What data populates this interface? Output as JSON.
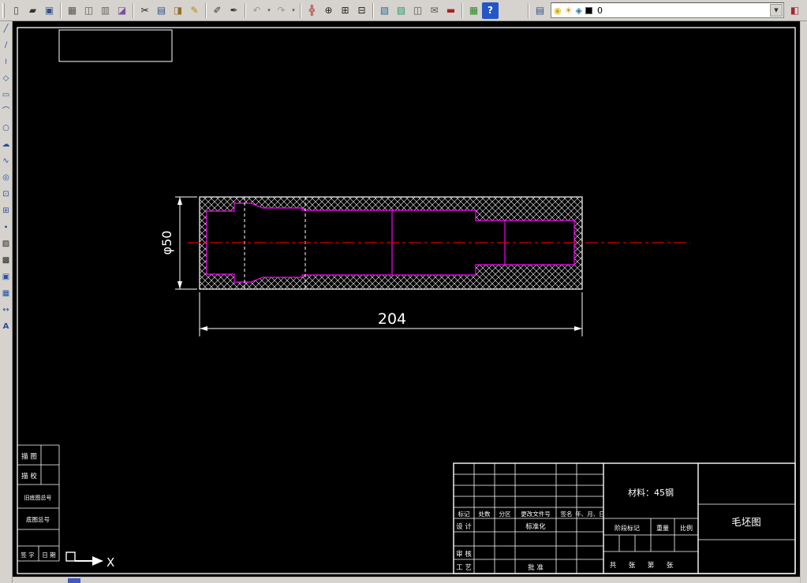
{
  "toolbar_top": {
    "items": [
      {
        "name": "toolbar-grip",
        "glyph": "",
        "cls": "tb-grip",
        "style": "",
        "inter": "true"
      },
      {
        "name": "new-file-icon",
        "glyph": "▯",
        "cls": "tb-btn",
        "style": "color:#444",
        "inter": "true"
      },
      {
        "name": "open-file-icon",
        "glyph": "▰",
        "cls": "tb-btn",
        "style": "color:#333",
        "inter": "true"
      },
      {
        "name": "save-icon",
        "glyph": "▣",
        "cls": "tb-btn",
        "style": "color:#35518f",
        "inter": "true"
      },
      {
        "name": "separator",
        "glyph": "",
        "cls": "tb-sep",
        "style": "",
        "inter": "false"
      },
      {
        "name": "print-icon",
        "glyph": "▦",
        "cls": "tb-btn",
        "style": "color:#555",
        "inter": "true"
      },
      {
        "name": "print-preview-icon",
        "glyph": "◫",
        "cls": "tb-btn",
        "style": "color:#555",
        "inter": "true"
      },
      {
        "name": "plot-icon",
        "glyph": "▥",
        "cls": "tb-btn",
        "style": "color:#666",
        "inter": "true"
      },
      {
        "name": "publish-icon",
        "glyph": "◪",
        "cls": "tb-btn",
        "style": "color:#7a4fa0",
        "inter": "true"
      },
      {
        "name": "separator",
        "glyph": "",
        "cls": "tb-sep",
        "style": "",
        "inter": "false"
      },
      {
        "name": "cut-icon",
        "glyph": "✂",
        "cls": "tb-btn",
        "style": "color:#222",
        "inter": "true"
      },
      {
        "name": "copy-icon",
        "glyph": "▤",
        "cls": "tb-btn",
        "style": "color:#35518f",
        "inter": "true"
      },
      {
        "name": "paste-icon",
        "glyph": "◨",
        "cls": "tb-btn",
        "style": "color:#946f27",
        "inter": "true"
      },
      {
        "name": "match-properties-icon",
        "glyph": "✎",
        "cls": "tb-btn",
        "style": "color:#b8860b",
        "inter": "true"
      },
      {
        "name": "separator",
        "glyph": "",
        "cls": "tb-sep",
        "style": "",
        "inter": "false"
      },
      {
        "name": "pencil-edit-icon",
        "glyph": "✐",
        "cls": "tb-btn",
        "style": "color:#333",
        "inter": "true"
      },
      {
        "name": "pen-edit-icon",
        "glyph": "✒",
        "cls": "tb-btn",
        "style": "color:#333",
        "inter": "true"
      },
      {
        "name": "separator",
        "glyph": "",
        "cls": "tb-sep",
        "style": "",
        "inter": "false"
      },
      {
        "name": "undo-icon",
        "glyph": "↶",
        "cls": "tb-btn",
        "style": "color:#999",
        "inter": "true"
      },
      {
        "name": "undo-caret-icon",
        "glyph": "▾",
        "cls": "tb-caret",
        "style": "",
        "inter": "true"
      },
      {
        "name": "redo-icon",
        "glyph": "↷",
        "cls": "tb-btn",
        "style": "color:#999",
        "inter": "true"
      },
      {
        "name": "redo-caret-icon",
        "glyph": "▾",
        "cls": "tb-caret",
        "style": "",
        "inter": "true"
      },
      {
        "name": "separator",
        "glyph": "",
        "cls": "tb-sep",
        "style": "",
        "inter": "false"
      },
      {
        "name": "pan-icon",
        "glyph": "╬",
        "cls": "tb-btn",
        "style": "color:#b22222",
        "inter": "true"
      },
      {
        "name": "zoom-realtime-icon",
        "glyph": "⊕",
        "cls": "tb-btn",
        "style": "color:#222",
        "inter": "true"
      },
      {
        "name": "zoom-window-icon",
        "glyph": "⊞",
        "cls": "tb-btn",
        "style": "color:#222",
        "inter": "true"
      },
      {
        "name": "zoom-previous-icon",
        "glyph": "⊟",
        "cls": "tb-btn",
        "style": "color:#222",
        "inter": "true"
      },
      {
        "name": "separator",
        "glyph": "",
        "cls": "tb-sep",
        "style": "",
        "inter": "false"
      },
      {
        "name": "design-center-icon",
        "glyph": "▧",
        "cls": "tb-btn",
        "style": "color:#2a6a9a",
        "inter": "true"
      },
      {
        "name": "tool-palettes-icon",
        "glyph": "▨",
        "cls": "tb-btn",
        "style": "color:#2a9a6a",
        "inter": "true"
      },
      {
        "name": "sheet-set-icon",
        "glyph": "◫",
        "cls": "tb-btn",
        "style": "color:#555",
        "inter": "true"
      },
      {
        "name": "markup-icon",
        "glyph": "✉",
        "cls": "tb-btn",
        "style": "color:#555",
        "inter": "true"
      },
      {
        "name": "reference-book-icon",
        "glyph": "▬",
        "cls": "tb-btn",
        "style": "color:#a22",
        "inter": "true"
      },
      {
        "name": "separator",
        "glyph": "",
        "cls": "tb-sep",
        "style": "",
        "inter": "false"
      },
      {
        "name": "table-icon",
        "glyph": "▦",
        "cls": "tb-btn",
        "style": "color:#2a8a2a",
        "inter": "true"
      },
      {
        "name": "help-icon",
        "glyph": "?",
        "cls": "tb-btn",
        "style": "background:#2457c5;color:#fff;border-radius:2px;font-weight:bold",
        "inter": "true"
      }
    ],
    "layer": {
      "value": "0"
    }
  },
  "toolbar_left": {
    "items": [
      {
        "name": "line-tool-icon",
        "glyph": "╱",
        "style": "color:#2a50a0",
        "inter": "true"
      },
      {
        "name": "xline-tool-icon",
        "glyph": "∕",
        "style": "color:#2a50a0",
        "inter": "true"
      },
      {
        "name": "polyline-tool-icon",
        "glyph": "≀",
        "style": "color:#2a50a0",
        "inter": "true"
      },
      {
        "name": "polygon-tool-icon",
        "glyph": "◇",
        "style": "color:#2a50a0",
        "inter": "true"
      },
      {
        "name": "rectangle-tool-icon",
        "glyph": "▭",
        "style": "color:#2a50a0",
        "inter": "true"
      },
      {
        "name": "arc-tool-icon",
        "glyph": "⌒",
        "style": "color:#2a50a0",
        "inter": "true"
      },
      {
        "name": "circle-tool-icon",
        "glyph": "○",
        "style": "color:#2a50a0",
        "inter": "true"
      },
      {
        "name": "revcloud-tool-icon",
        "glyph": "☁",
        "style": "color:#2a50a0",
        "inter": "true"
      },
      {
        "name": "spline-tool-icon",
        "glyph": "∿",
        "style": "color:#2a50a0",
        "inter": "true"
      },
      {
        "name": "ellipse-tool-icon",
        "glyph": "◎",
        "style": "color:#2a50a0",
        "inter": "true"
      },
      {
        "name": "insert-block-tool-icon",
        "glyph": "⊡",
        "style": "color:#2a50a0",
        "inter": "true"
      },
      {
        "name": "make-block-tool-icon",
        "glyph": "⊞",
        "style": "color:#2a50a0",
        "inter": "true"
      },
      {
        "name": "point-tool-icon",
        "glyph": "∙",
        "style": "color:#2a50a0",
        "inter": "true"
      },
      {
        "name": "hatch-tool-icon",
        "glyph": "▨",
        "style": "color:#222",
        "inter": "true"
      },
      {
        "name": "gradient-tool-icon",
        "glyph": "▩",
        "style": "color:#222",
        "inter": "true"
      },
      {
        "name": "region-tool-icon",
        "glyph": "▣",
        "style": "color:#2a50a0",
        "inter": "true"
      },
      {
        "name": "table-tool-icon",
        "glyph": "▦",
        "style": "color:#2a50a0",
        "inter": "true"
      },
      {
        "name": "dimension-tool-icon",
        "glyph": "↔",
        "style": "color:#2a50a0",
        "inter": "true"
      },
      {
        "name": "mtext-tool-icon",
        "glyph": "A",
        "style": "color:#2a50a0;font-weight:bold",
        "inter": "true"
      }
    ]
  },
  "drawing": {
    "dim_length": "204",
    "dim_diameter": "φ50",
    "axis_label": "X"
  },
  "title_block": {
    "material": "材料：45钢",
    "drawing_title": "毛坯图",
    "rev_header": [
      "标记",
      "处数",
      "分区",
      "更改文件号",
      "签名",
      "年、月、日"
    ],
    "row_design": "设 计",
    "row_standard": "标准化",
    "row_check": "审 核",
    "row_process": "工 艺",
    "row_approve": "批 准",
    "stage_mark": "阶段标记",
    "weight": "重量",
    "scale": "比例",
    "sheet": [
      "共",
      "张",
      "第",
      "张"
    ]
  },
  "left_table": {
    "rows": [
      "描 图",
      "描 校",
      "旧底图总号",
      "底图总号"
    ],
    "sign": "签 字",
    "date": "日 期"
  },
  "colors": {
    "outline": "#ffffff",
    "part": "#ff00ff",
    "centerline": "#d00000",
    "canvas": "#000000"
  }
}
